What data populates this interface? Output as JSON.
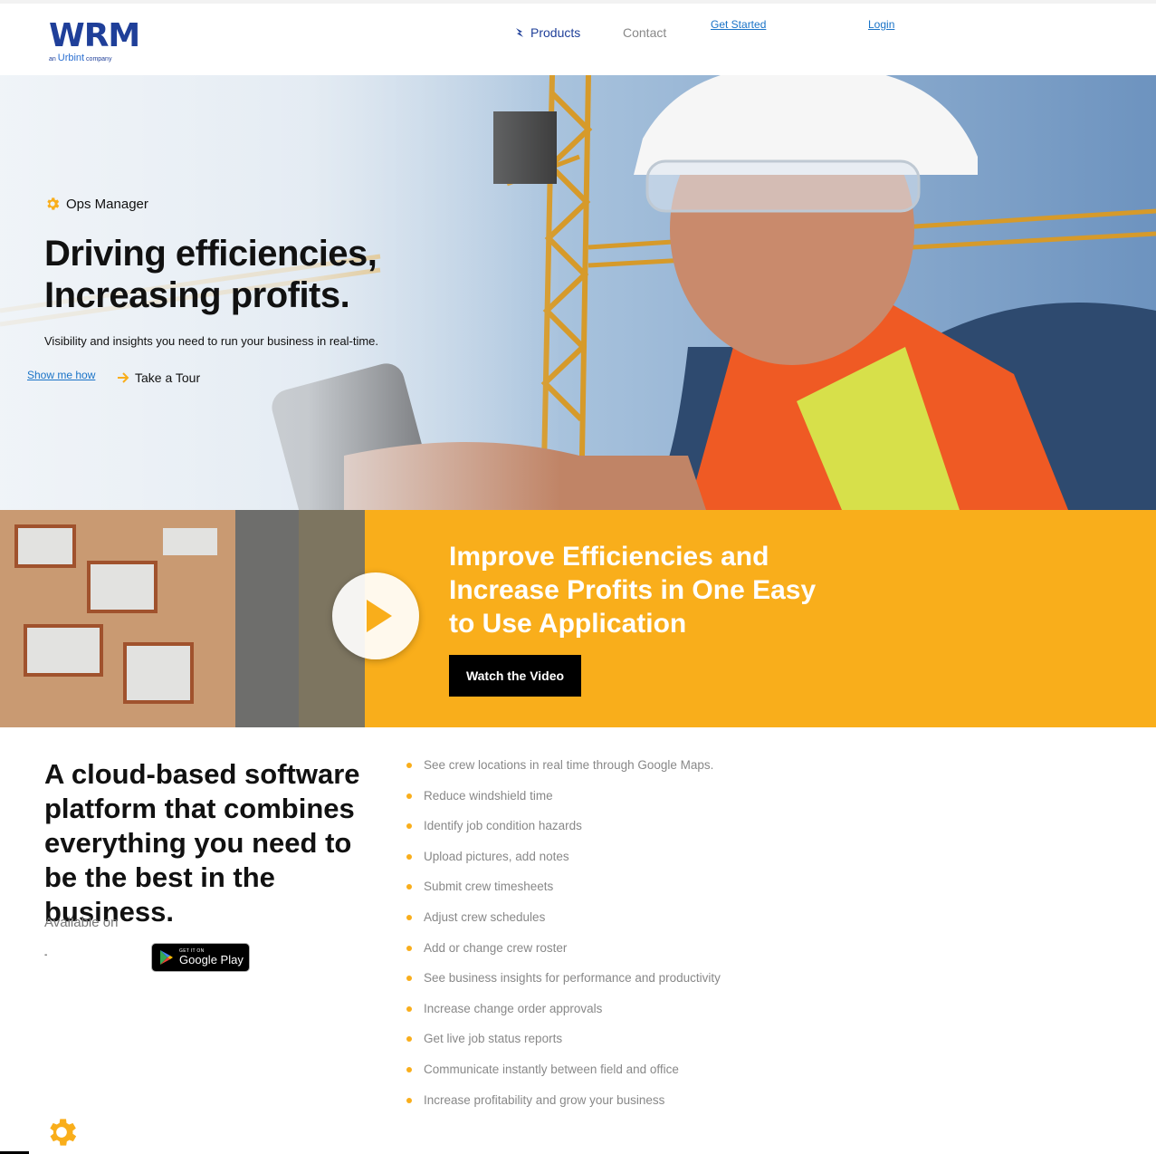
{
  "header": {
    "logo_main": "WRM",
    "logo_sub_prefix": "an",
    "logo_sub_brand": "Urbint",
    "logo_sub_suffix": "company",
    "nav_products": "Products",
    "nav_contact": "Contact",
    "nav_get_started": "Get Started",
    "nav_login": "Login"
  },
  "hero": {
    "badge": "Ops Manager",
    "title_line1": "Driving efficiencies,",
    "title_line2": "Increasing profits.",
    "subtitle": "Visibility and insights you need to run your business in real-time.",
    "show_me_how": "Show me how",
    "take_tour": "Take a Tour"
  },
  "band": {
    "title": "Improve Efficiencies and Increase Profits in One Easy to Use Application",
    "button": "Watch the Video"
  },
  "platform": {
    "title": "A cloud-based software platform that combines everything you need to be the best in the business.",
    "available_on": "Available on",
    "dash": "-",
    "gplay_small": "GET IT ON",
    "gplay_big": "Google Play"
  },
  "features": [
    "See crew locations in real time through Google Maps.",
    "Reduce windshield time",
    "Identify job condition hazards",
    "Upload pictures, add notes",
    "Submit crew timesheets",
    "Adjust crew schedules",
    "Add or change crew roster",
    "See business insights for performance and productivity",
    "Increase change order approvals",
    "Get live job status reports",
    "Communicate instantly between field and office",
    "Increase profitability and grow your business"
  ],
  "colors": {
    "brand_blue": "#1f3f99",
    "accent_orange": "#f9ae1b",
    "link_blue": "#1a73c7"
  },
  "icons": {
    "badge": "gear-icon",
    "products": "bolt-icon",
    "tour": "arrow-right-icon",
    "play": "play-icon",
    "gplay": "google-play-icon"
  }
}
